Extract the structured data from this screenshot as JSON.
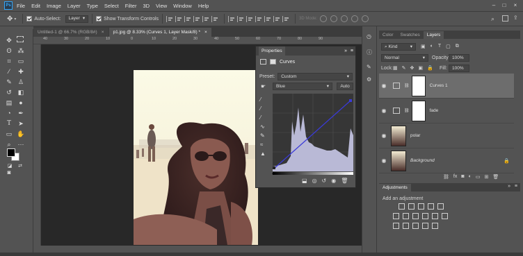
{
  "menu": {
    "logo": "Ps",
    "items": [
      "File",
      "Edit",
      "Image",
      "Layer",
      "Type",
      "Select",
      "Filter",
      "3D",
      "View",
      "Window",
      "Help"
    ]
  },
  "options": {
    "auto_select_label": "Auto-Select:",
    "auto_select_value": "Layer",
    "transform_label": "Show Transform Controls",
    "mode_3d": "3D Mode:"
  },
  "tabs": [
    {
      "label": "Untitled-1 @ 66.7% (RGB/8#)",
      "close": "×"
    },
    {
      "label": "p1.jpg @ 8.33% (Curves 1, Layer Mask/8) *",
      "close": "×"
    }
  ],
  "ruler": [
    "40",
    "30",
    "20",
    "10",
    "0",
    "10",
    "20",
    "30",
    "40",
    "50",
    "60",
    "70",
    "80",
    "90"
  ],
  "properties": {
    "tab": "Properties",
    "title": "Curves",
    "preset_label": "Preset:",
    "preset_value": "Custom",
    "channel": "Blue",
    "auto": "Auto"
  },
  "layers_panel": {
    "tabs": [
      "Color",
      "Swatches",
      "Layers"
    ],
    "kind": "Kind",
    "blend_mode": "Normal",
    "opacity_label": "Opacity:",
    "opacity_value": "100%",
    "lock_label": "Lock:",
    "fill_label": "Fill:",
    "fill_value": "100%",
    "layers": [
      {
        "name": "Curves 1",
        "selected": true
      },
      {
        "name": "fade",
        "selected": false
      },
      {
        "name": "polar",
        "selected": false
      },
      {
        "name": "Background",
        "selected": false
      }
    ]
  },
  "adjustments": {
    "tab": "Adjustments",
    "add_label": "Add an adjustment"
  },
  "colors": {
    "curve_line": "#3a3ad8",
    "histogram": "#b9b9d6",
    "accent": "#31a8ff"
  }
}
